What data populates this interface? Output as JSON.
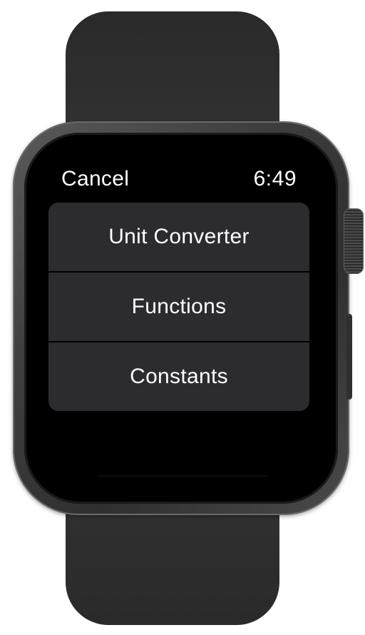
{
  "status_bar": {
    "cancel_label": "Cancel",
    "time": "6:49"
  },
  "menu": {
    "items": [
      {
        "label": "Unit Converter"
      },
      {
        "label": "Functions"
      },
      {
        "label": "Constants"
      }
    ]
  },
  "colors": {
    "screen_background": "#000000",
    "menu_item_background": "#2c2c2e",
    "text": "#ffffff",
    "band": "#2e2e2e"
  }
}
